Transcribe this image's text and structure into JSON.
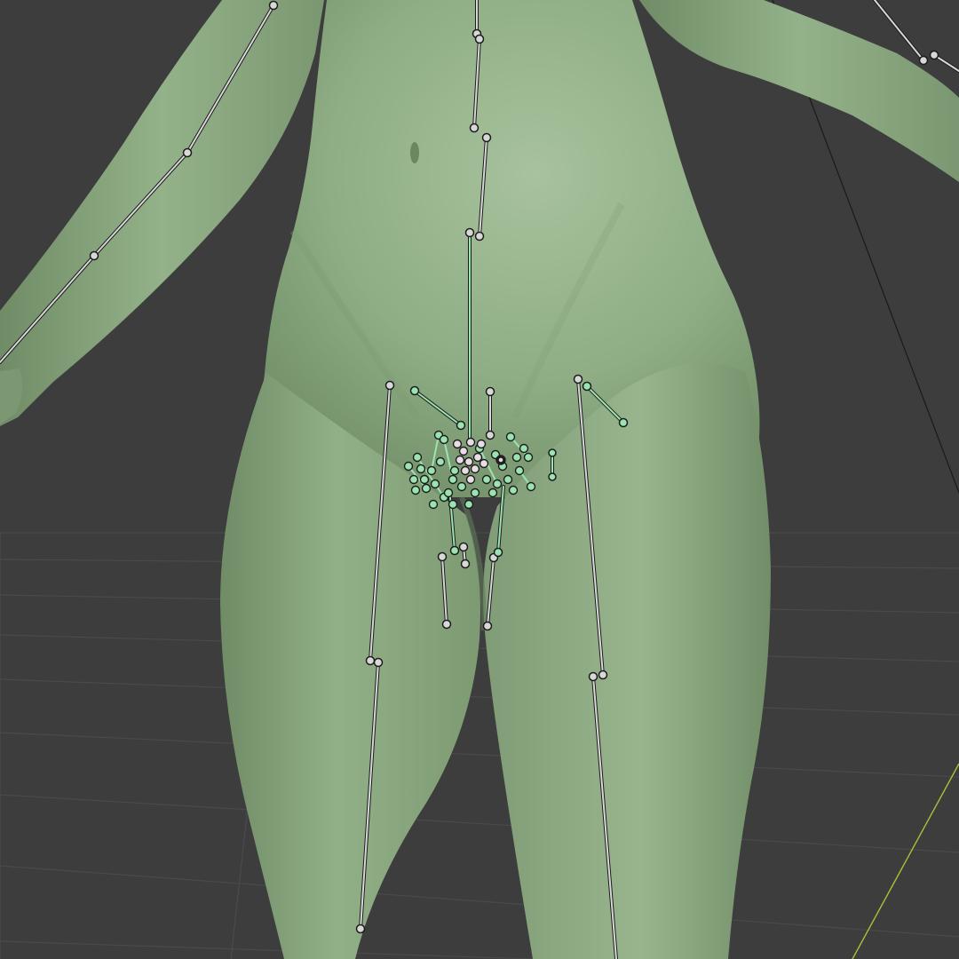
{
  "viewport": {
    "background_color": "#3d3d3d",
    "grid_line_color": "#4a4a4a",
    "mesh_color": "#8fae85",
    "mesh_shadow_color": "#5f7a58",
    "bone_outline_color": "#1c1c1c",
    "bone_fill_color": "#d8d8d8",
    "selected_bone_color": "#9be3b0",
    "axis_x_color": "#a9c23a",
    "grid_visible": true,
    "view": "perspective"
  }
}
